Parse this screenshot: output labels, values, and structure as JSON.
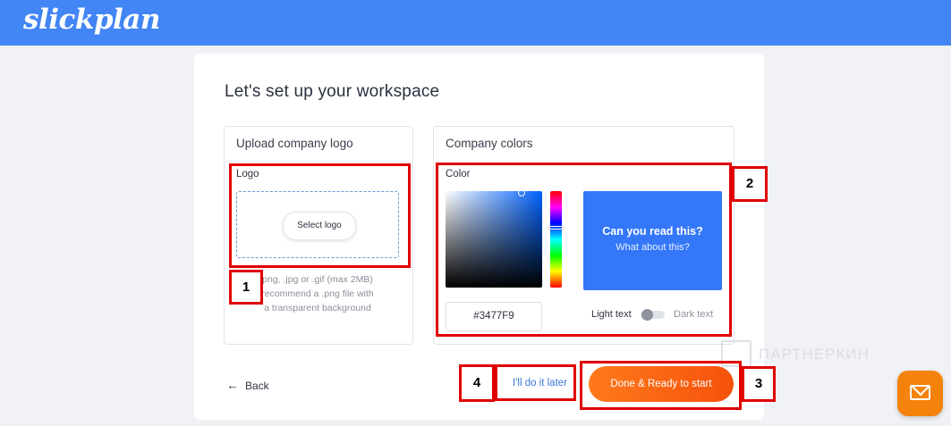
{
  "header": {
    "brand": "slickplan"
  },
  "card": {
    "title": "Let's set up your workspace"
  },
  "logo_panel": {
    "title": "Upload company logo",
    "field_label": "Logo",
    "select_button": "Select logo",
    "hint_line1": "png, .jpg or .gif (max 2MB)",
    "hint_line2": "recommend a .png file with",
    "hint_line3": "a transparent background"
  },
  "colors_panel": {
    "title": "Company colors",
    "field_label": "Color",
    "hex_value": "#3477F9",
    "preview_heading": "Can you read this?",
    "preview_sub": "What about this?",
    "light_text_label": "Light text",
    "dark_text_label": "Dark text",
    "preview_color": "#3477F9"
  },
  "footer": {
    "back_label": "Back",
    "later_label": "I'll do it later",
    "done_label": "Done & Ready to start"
  },
  "annotations": {
    "n1": "1",
    "n2": "2",
    "n3": "3",
    "n4": "4"
  },
  "watermark": {
    "text": "ПАРТНЕРКИН"
  },
  "colors": {
    "header": "#4285F4",
    "accent_orange": "#F5820A",
    "annotation_red": "#E00000",
    "link_blue": "#3A77D6"
  }
}
